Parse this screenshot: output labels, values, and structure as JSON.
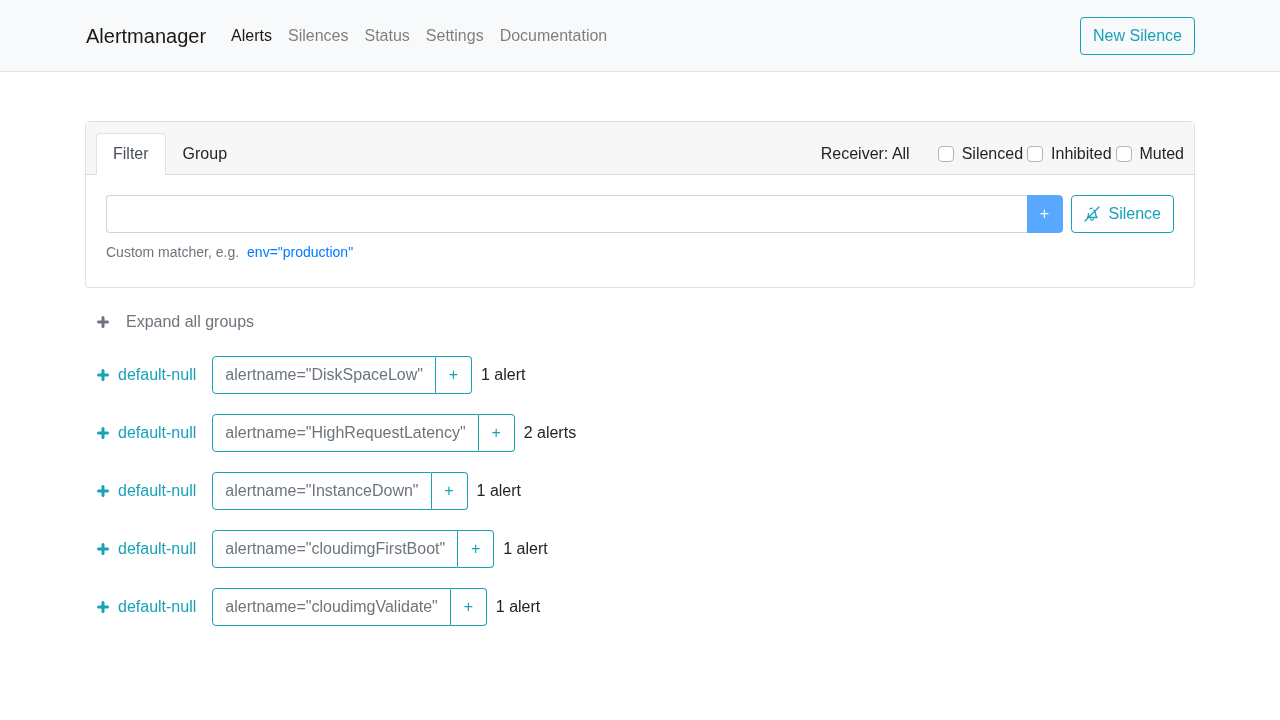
{
  "navbar": {
    "brand": "Alertmanager",
    "links": [
      {
        "label": "Alerts",
        "selected": true
      },
      {
        "label": "Silences",
        "selected": false
      },
      {
        "label": "Status",
        "selected": false
      },
      {
        "label": "Settings",
        "selected": false
      },
      {
        "label": "Documentation",
        "selected": false
      }
    ],
    "new_silence_button": "New Silence"
  },
  "filter_panel": {
    "tabs": [
      {
        "label": "Filter",
        "selected": true
      },
      {
        "label": "Group",
        "selected": false
      }
    ],
    "receiver": "Receiver: All",
    "toggles": [
      {
        "label": "Silenced",
        "checked": false
      },
      {
        "label": "Inhibited",
        "checked": false
      },
      {
        "label": "Muted",
        "checked": false
      }
    ],
    "add_button": {
      "label": "+",
      "disabled": true
    },
    "silence_button": "Silence",
    "hint": "Custom matcher, e.g.",
    "example": "env=\"production\""
  },
  "alert_groups": {
    "expand_all": "Expand all groups",
    "groups": [
      {
        "receiver": "default-null",
        "matcher": "alertname=\"DiskSpaceLow\"",
        "add_label": "+",
        "count": "1 alert"
      },
      {
        "receiver": "default-null",
        "matcher": "alertname=\"HighRequestLatency\"",
        "add_label": "+",
        "count": "2 alerts"
      },
      {
        "receiver": "default-null",
        "matcher": "alertname=\"InstanceDown\"",
        "add_label": "+",
        "count": "1 alert"
      },
      {
        "receiver": "default-null",
        "matcher": "alertname=\"cloudimgFirstBoot\"",
        "add_label": "+",
        "count": "1 alert"
      },
      {
        "receiver": "default-null",
        "matcher": "alertname=\"cloudimgValidate\"",
        "add_label": "+",
        "count": "1 alert"
      }
    ]
  }
}
